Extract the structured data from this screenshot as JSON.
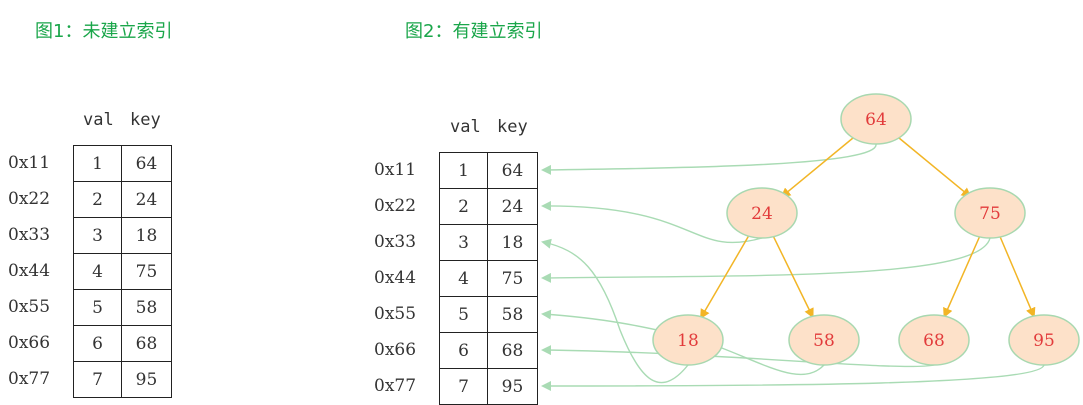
{
  "fig1": {
    "title": "图1：未建立索引",
    "header": {
      "val": "val",
      "key": "key"
    },
    "rows": [
      {
        "addr": "0x11",
        "val": "1",
        "key": "64"
      },
      {
        "addr": "0x22",
        "val": "2",
        "key": "24"
      },
      {
        "addr": "0x33",
        "val": "3",
        "key": "18"
      },
      {
        "addr": "0x44",
        "val": "4",
        "key": "75"
      },
      {
        "addr": "0x55",
        "val": "5",
        "key": "58"
      },
      {
        "addr": "0x66",
        "val": "6",
        "key": "68"
      },
      {
        "addr": "0x77",
        "val": "7",
        "key": "95"
      }
    ]
  },
  "fig2": {
    "title": "图2：有建立索引",
    "header": {
      "val": "val",
      "key": "key"
    },
    "rows": [
      {
        "addr": "0x11",
        "val": "1",
        "key": "64"
      },
      {
        "addr": "0x22",
        "val": "2",
        "key": "24"
      },
      {
        "addr": "0x33",
        "val": "3",
        "key": "18"
      },
      {
        "addr": "0x44",
        "val": "4",
        "key": "75"
      },
      {
        "addr": "0x55",
        "val": "5",
        "key": "58"
      },
      {
        "addr": "0x66",
        "val": "6",
        "key": "68"
      },
      {
        "addr": "0x77",
        "val": "7",
        "key": "95"
      }
    ],
    "tree": {
      "nodes": [
        {
          "id": "n64",
          "label": "64"
        },
        {
          "id": "n24",
          "label": "24"
        },
        {
          "id": "n75",
          "label": "75"
        },
        {
          "id": "n18",
          "label": "18"
        },
        {
          "id": "n58",
          "label": "58"
        },
        {
          "id": "n68",
          "label": "68"
        },
        {
          "id": "n95",
          "label": "95"
        }
      ],
      "edges": [
        [
          "n64",
          "n24"
        ],
        [
          "n64",
          "n75"
        ],
        [
          "n24",
          "n18"
        ],
        [
          "n24",
          "n58"
        ],
        [
          "n75",
          "n68"
        ],
        [
          "n75",
          "n95"
        ]
      ],
      "pointers": [
        {
          "node": "n64",
          "row": 0
        },
        {
          "node": "n24",
          "row": 1
        },
        {
          "node": "n18",
          "row": 2
        },
        {
          "node": "n75",
          "row": 3
        },
        {
          "node": "n58",
          "row": 4
        },
        {
          "node": "n68",
          "row": 5
        },
        {
          "node": "n95",
          "row": 6
        }
      ]
    }
  },
  "colors": {
    "title": "#1aa64a",
    "node_fill": "#fde1c9",
    "node_stroke": "#a8d8b0",
    "node_text": "#e23b3b",
    "tree_edge": "#f2b526",
    "pointer": "#a9dbb4",
    "table_border": "#222222"
  }
}
